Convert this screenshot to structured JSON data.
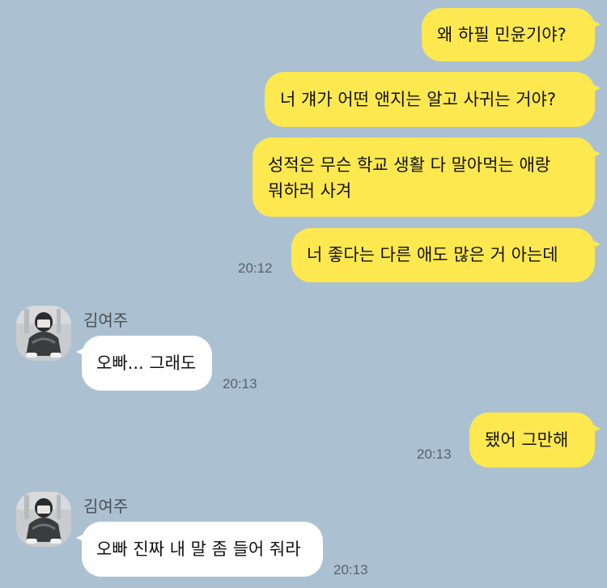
{
  "messages": [
    {
      "text": "왜 하필 민윤기야?"
    },
    {
      "text": "너 걔가 어떤 앤지는 알고 사귀는 거야?"
    },
    {
      "lines": [
        "성적은 무슨 학교 생활 다 말아먹는 애랑",
        "뭐하러 사겨"
      ]
    },
    {
      "text": "너 좋다는 다른 애도 많은 거 아는데",
      "time": "20:12"
    },
    {
      "sender": "김여주",
      "text": "오빠... 그래도",
      "time": "20:13"
    },
    {
      "text": "됐어 그만해",
      "time": "20:13"
    },
    {
      "sender": "김여주",
      "text": "오빠 진짜 내 말 좀 들어 줘라",
      "time": "20:13"
    }
  ]
}
